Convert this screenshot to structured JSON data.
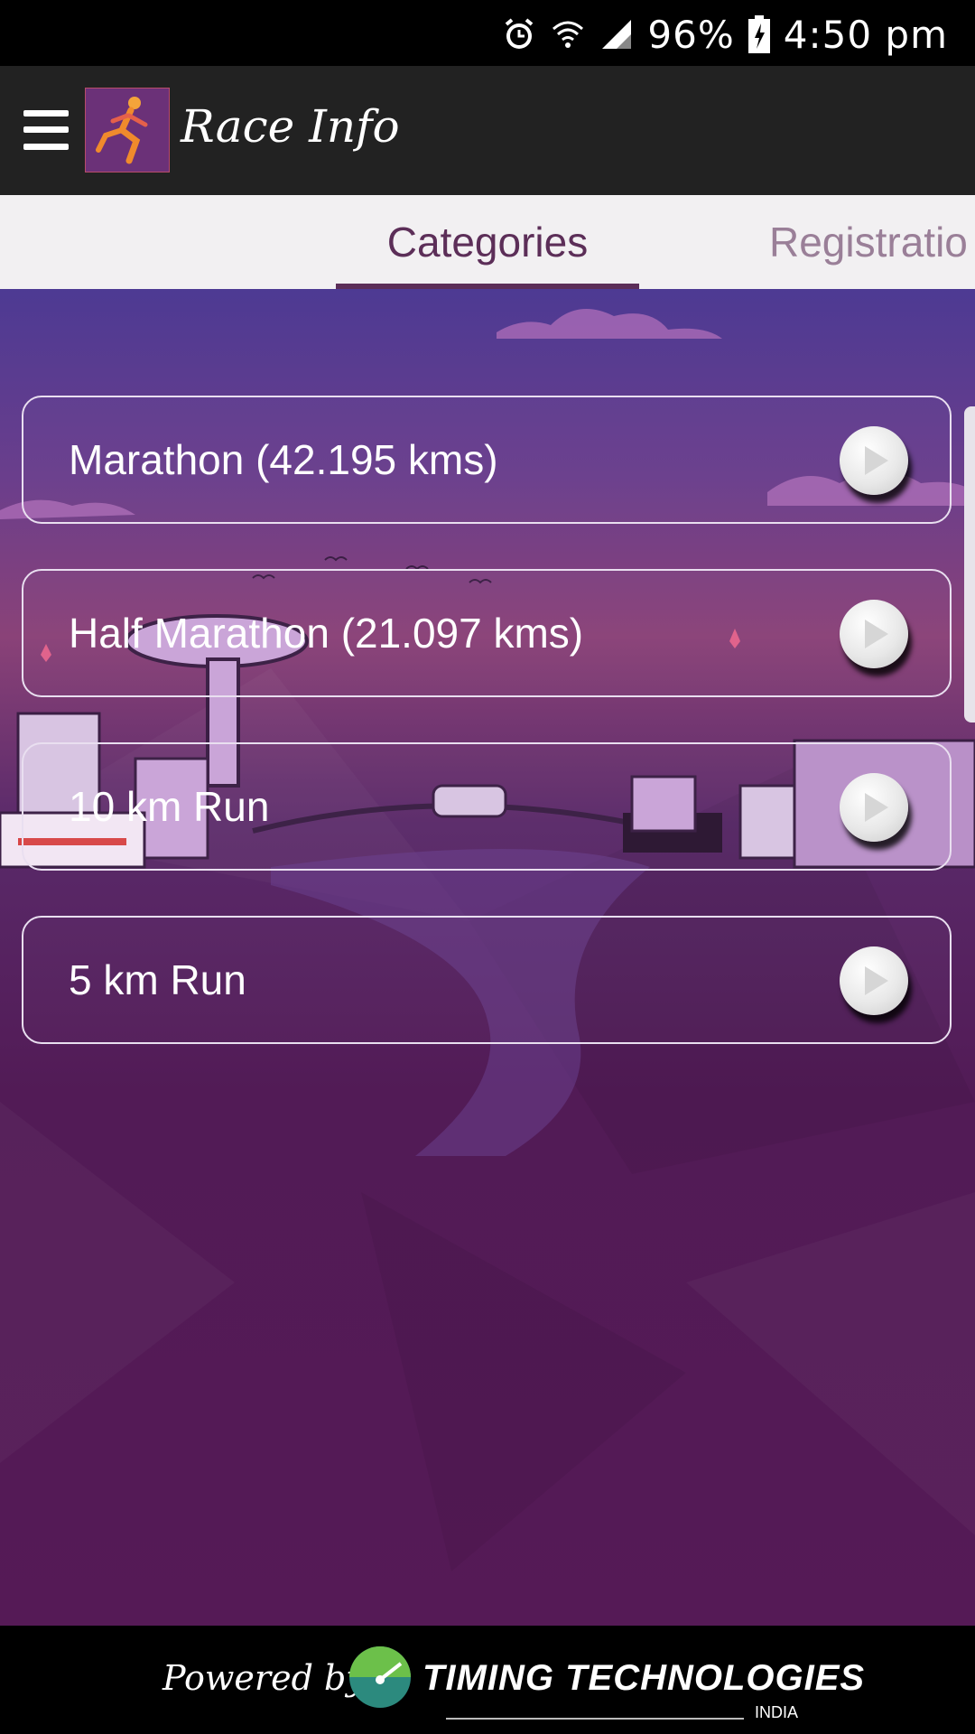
{
  "status_bar": {
    "battery": "96%",
    "time": "4:50 pm",
    "icons": [
      "alarm-icon",
      "wifi-icon",
      "signal-icon",
      "battery-charging-icon"
    ]
  },
  "app_bar": {
    "title": "Race Info",
    "menu_icon": "hamburger-menu-icon",
    "logo_icon": "runner-logo-icon"
  },
  "tabs": [
    {
      "label": "Categories",
      "active": true
    },
    {
      "label": "Registratio",
      "active": false
    }
  ],
  "categories": [
    {
      "label": "Marathon (42.195 kms)"
    },
    {
      "label": "Half Marathon (21.097 kms)"
    },
    {
      "label": "10 km Run"
    },
    {
      "label": "5 km Run"
    }
  ],
  "footer": {
    "powered_by": "Powered by",
    "brand": "TIMING TECHNOLOGIES",
    "brand_sub": "INDIA"
  },
  "colors": {
    "app_bar": "#222222",
    "tab_active": "#5c2e58",
    "tab_inactive": "#9a7f98",
    "background_top": "#4d3a93",
    "background_bottom": "#551a56"
  }
}
